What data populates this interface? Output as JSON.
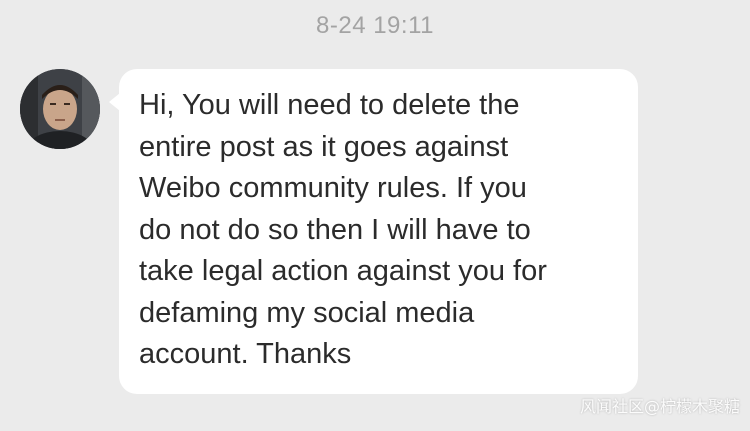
{
  "conversation": {
    "timestamp": "8-24 19:11",
    "messages": [
      {
        "sender": "contact",
        "text": "Hi, You will need to delete the\nentire post as it goes against\nWeibo community rules. If you\ndo not do so then I will have to\ntake legal action against you for\ndefaming my social media\naccount. Thanks"
      }
    ]
  },
  "watermark": "风闻社区@柠檬木聚糖",
  "colors": {
    "background": "#ebebeb",
    "bubble": "#ffffff",
    "message_text": "#2b2b2b",
    "timestamp_text": "#a3a3a3"
  }
}
